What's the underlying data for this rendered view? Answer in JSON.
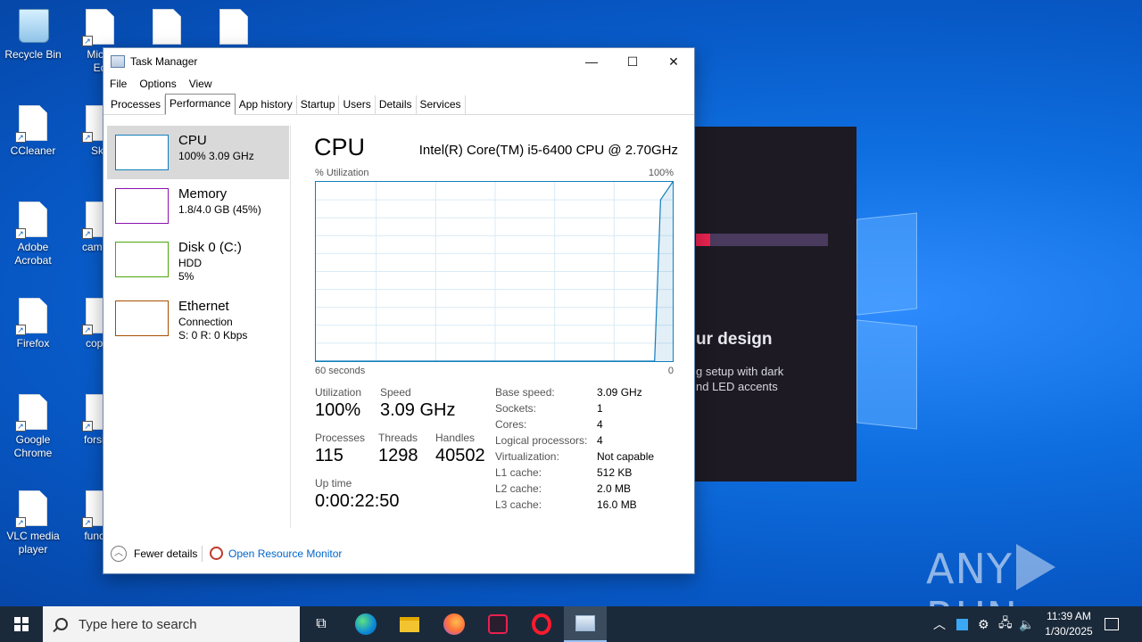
{
  "desktop": {
    "icons": [
      {
        "label": "Recycle Bin",
        "icon": "recycle-bin-icon"
      },
      {
        "label": "Micro\nEd",
        "icon": "edge-shortcut-icon"
      },
      {
        "label": "CCleaner",
        "icon": "ccleaner-icon"
      },
      {
        "label": "Sky",
        "icon": "skype-icon"
      },
      {
        "label": "Adobe\nAcrobat",
        "icon": "acrobat-icon"
      },
      {
        "label": "camera",
        "icon": "file-icon"
      },
      {
        "label": "Firefox",
        "icon": "firefox-shortcut-icon"
      },
      {
        "label": "copyri",
        "icon": "file-icon"
      },
      {
        "label": "Google\nChrome",
        "icon": "chrome-shortcut-icon"
      },
      {
        "label": "forsing",
        "icon": "file-icon"
      },
      {
        "label": "VLC media\nplayer",
        "icon": "vlc-icon"
      },
      {
        "label": "functio",
        "icon": "file-icon"
      }
    ],
    "promo": {
      "heading": "ur design",
      "sub": "g setup with dark\nnd LED accents",
      "accent": "#e8224f"
    },
    "watermark": {
      "left": "ANY",
      "right": "RUN"
    }
  },
  "task_manager": {
    "title": "Task Manager",
    "window_buttons": {
      "minimize": "—",
      "maximize": "☐",
      "close": "✕"
    },
    "menu": [
      "File",
      "Options",
      "View"
    ],
    "tabs": [
      "Processes",
      "Performance",
      "App history",
      "Startup",
      "Users",
      "Details",
      "Services"
    ],
    "active_tab": "Performance",
    "sidebar": [
      {
        "name": "CPU",
        "line2": "100%  3.09 GHz",
        "line3": "",
        "color": "#117dbb",
        "selected": true
      },
      {
        "name": "Memory",
        "line2": "1.8/4.0 GB (45%)",
        "line3": "",
        "color": "#8b12ae",
        "selected": false
      },
      {
        "name": "Disk 0 (C:)",
        "line2": "HDD",
        "line3": "5%",
        "color": "#4da60c",
        "selected": false
      },
      {
        "name": "Ethernet",
        "line2": "Connection",
        "line3": "S: 0 R: 0 Kbps",
        "color": "#a74f01",
        "selected": false
      }
    ],
    "main": {
      "title": "CPU",
      "model": "Intel(R) Core(TM) i5-6400 CPU @ 2.70GHz",
      "graph": {
        "y_label": "% Utilization",
        "y_max_label": "100%",
        "x_left_label": "60 seconds",
        "x_right_label": "0",
        "line_color": "#117dbb",
        "grid_color": "#d9eaf4",
        "series_pct": [
          0,
          0,
          0,
          0,
          0,
          0,
          0,
          0,
          0,
          0,
          0,
          0,
          0,
          0,
          0,
          0,
          0,
          0,
          0,
          0,
          0,
          0,
          0,
          0,
          0,
          0,
          0,
          0,
          0,
          0,
          0,
          0,
          0,
          0,
          0,
          0,
          0,
          0,
          0,
          0,
          0,
          0,
          0,
          0,
          0,
          0,
          0,
          0,
          0,
          0,
          0,
          0,
          0,
          0,
          0,
          0,
          0,
          90,
          95,
          100
        ]
      },
      "stats": {
        "utilization_label": "Utilization",
        "utilization": "100%",
        "speed_label": "Speed",
        "speed": "3.09 GHz",
        "processes_label": "Processes",
        "processes": "115",
        "threads_label": "Threads",
        "threads": "1298",
        "handles_label": "Handles",
        "handles": "40502",
        "uptime_label": "Up time",
        "uptime": "0:00:22:50"
      },
      "details": [
        {
          "k": "Base speed:",
          "v": "3.09 GHz"
        },
        {
          "k": "Sockets:",
          "v": "1"
        },
        {
          "k": "Cores:",
          "v": "4"
        },
        {
          "k": "Logical processors:",
          "v": "4"
        },
        {
          "k": "Virtualization:",
          "v": "Not capable"
        },
        {
          "k": "L1 cache:",
          "v": "512 KB"
        },
        {
          "k": "L2 cache:",
          "v": "2.0 MB"
        },
        {
          "k": "L3 cache:",
          "v": "16.0 MB"
        }
      ]
    },
    "footer": {
      "fewer_details": "Fewer details",
      "open_resource_monitor": "Open Resource Monitor"
    }
  },
  "taskbar": {
    "search_placeholder": "Type here to search",
    "pinned": [
      {
        "name": "task-view-icon",
        "active": false
      },
      {
        "name": "edge-icon",
        "active": false
      },
      {
        "name": "file-explorer-icon",
        "active": false
      },
      {
        "name": "firefox-icon",
        "active": false
      },
      {
        "name": "app-icon",
        "active": false
      },
      {
        "name": "opera-icon",
        "active": false
      },
      {
        "name": "task-manager-icon",
        "active": true
      }
    ],
    "time": "11:39 AM",
    "date": "1/30/2025"
  }
}
